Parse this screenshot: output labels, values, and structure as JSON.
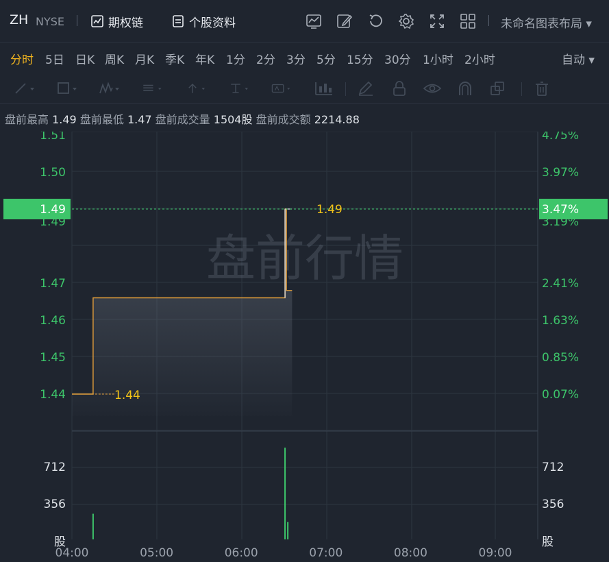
{
  "header": {
    "symbol": "ZH",
    "exchange": "NYSE",
    "options_chain_label": "期权链",
    "profile_label": "个股资料",
    "layout_name": "未命名图表布局 ▾",
    "icons": [
      "chart-line-icon",
      "edit-icon",
      "undo-icon",
      "gear-icon",
      "fullscreen-icon",
      "grid-layout-icon"
    ]
  },
  "periods": {
    "items": [
      "分时",
      "5日",
      "日K",
      "周K",
      "月K",
      "季K",
      "年K",
      "1分",
      "2分",
      "3分",
      "5分",
      "15分",
      "30分",
      "1小时",
      "2小时"
    ],
    "active": "分时",
    "auto_label": "自动 ▾"
  },
  "drawing_tools": [
    "line-tool-icon",
    "rectangle-tool-icon",
    "wave-tool-icon",
    "text-list-tool-icon",
    "arrow-tool-icon",
    "measure-tool-icon",
    "text-box-tool-icon",
    "indicator-tool-icon",
    "pen-icon",
    "lock-icon",
    "eye-icon",
    "magnet-icon",
    "copy-icon",
    "trash-icon"
  ],
  "premarket": {
    "high_label": "盘前最高",
    "high": "1.49",
    "low_label": "盘前最低",
    "low": "1.47",
    "volume_label": "盘前成交量",
    "volume": "1504股",
    "amount_label": "盘前成交额",
    "amount": "2214.88"
  },
  "colors": {
    "price_line": "#e8a13a",
    "axis_green": "#3dc56a",
    "highlight_bg": "#3dc56a",
    "volume_bar": "#3dc56a",
    "label_yellow": "#f2c318",
    "grid": "#2d3641"
  },
  "chart_data": {
    "type": "line",
    "watermark": "盘前行情",
    "x_ticks": [
      "04:00",
      "05:00",
      "06:00",
      "07:00",
      "08:00",
      "09:00"
    ],
    "y_ticks_left": [
      "1.51",
      "1.50",
      "1.49",
      "1.47",
      "1.46",
      "1.45",
      "1.44"
    ],
    "y_ticks_left_values": [
      1.51,
      1.5,
      1.49,
      1.47,
      1.46,
      1.45,
      1.44
    ],
    "y_ticks_right": [
      "4.75%",
      "3.97%",
      "3.19%",
      "2.41%",
      "1.63%",
      "0.85%",
      "0.07%"
    ],
    "current_price": "1.49",
    "current_pct": "3.47%",
    "start_label": "1.44",
    "end_label": "1.49",
    "price_series": [
      {
        "time": "04:00",
        "price": 1.44
      },
      {
        "time": "04:14",
        "price": 1.44
      },
      {
        "time": "04:15",
        "price": 1.466
      },
      {
        "time": "06:30",
        "price": 1.466
      },
      {
        "time": "06:31",
        "price": 1.49
      },
      {
        "time": "06:32",
        "price": 1.468
      },
      {
        "time": "06:36",
        "price": 1.468
      }
    ],
    "volume_ticks": [
      "712",
      "356",
      "股"
    ],
    "volume_tick_values": [
      712,
      356
    ],
    "volume_series": [
      {
        "time": "04:15",
        "volume": 260
      },
      {
        "time": "06:31",
        "volume": 895
      },
      {
        "time": "06:32",
        "volume": 180
      }
    ]
  }
}
